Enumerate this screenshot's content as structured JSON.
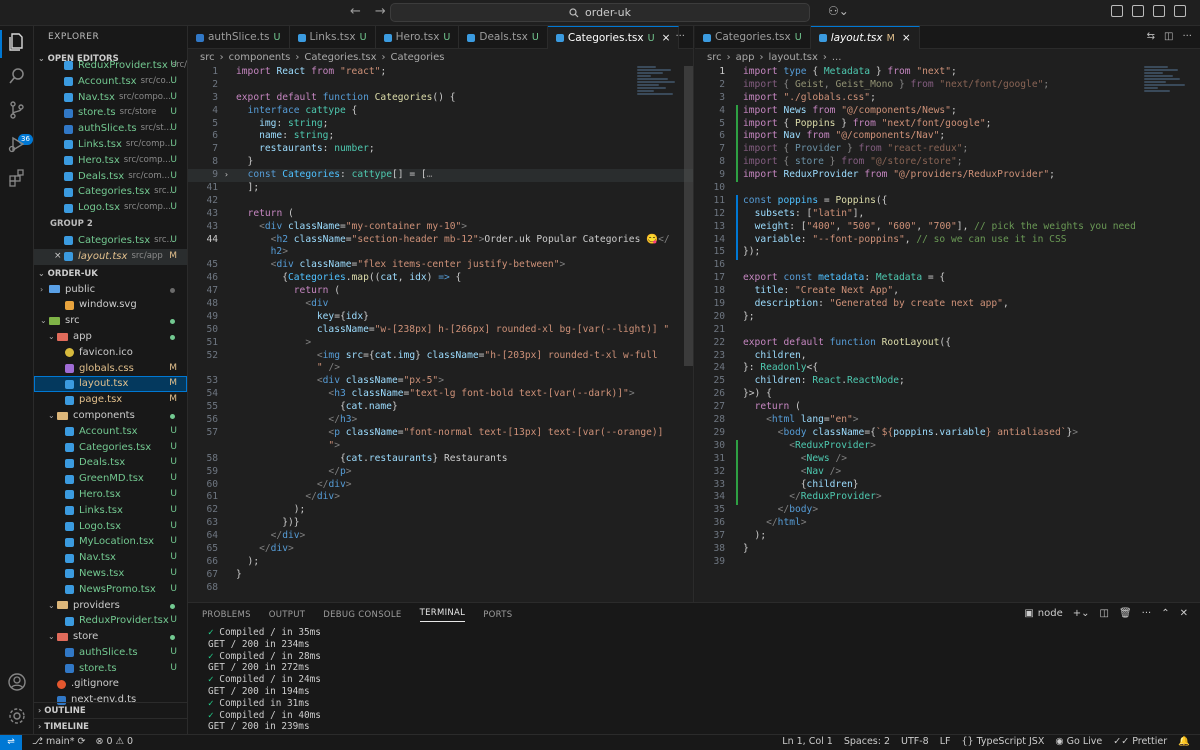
{
  "titlebar": {
    "back": "←",
    "forward": "→",
    "search_text": "order-uk"
  },
  "activity": {
    "badge": "36"
  },
  "sidebar": {
    "title": "EXPLORER",
    "open_editors_label": "OPEN EDITORS",
    "group2_label": "GROUP 2",
    "order_label": "ORDER-UK",
    "outline_label": "OUTLINE",
    "timeline_label": "TIMELINE",
    "open_editors": [
      {
        "name": "ReduxProvider.tsx",
        "path": "src/...",
        "status": "U",
        "icon": "tsx"
      },
      {
        "name": "Account.tsx",
        "path": "src/co...",
        "status": "U",
        "icon": "tsx"
      },
      {
        "name": "Nav.tsx",
        "path": "src/compo...",
        "status": "U",
        "icon": "tsx"
      },
      {
        "name": "store.ts",
        "path": "src/store",
        "status": "U",
        "icon": "ts"
      },
      {
        "name": "authSlice.ts",
        "path": "src/st...",
        "status": "U",
        "icon": "ts"
      },
      {
        "name": "Links.tsx",
        "path": "src/comp...",
        "status": "U",
        "icon": "tsx"
      },
      {
        "name": "Hero.tsx",
        "path": "src/comp...",
        "status": "U",
        "icon": "tsx"
      },
      {
        "name": "Deals.tsx",
        "path": "src/com...",
        "status": "U",
        "icon": "tsx"
      },
      {
        "name": "Categories.tsx",
        "path": "src...",
        "status": "U",
        "icon": "tsx"
      },
      {
        "name": "Logo.tsx",
        "path": "src/comp...",
        "status": "U",
        "icon": "tsx"
      }
    ],
    "group2": [
      {
        "name": "Categories.tsx",
        "path": "src...",
        "status": "U",
        "icon": "tsx"
      },
      {
        "name": "layout.tsx",
        "path": "src/app",
        "status": "M",
        "icon": "tsx"
      }
    ],
    "tree": [
      {
        "name": "public",
        "indent": 1,
        "type": "folder",
        "color": "blue",
        "chev": "›",
        "dot": "grey"
      },
      {
        "name": "window.svg",
        "indent": 3,
        "icon": "svg"
      },
      {
        "name": "src",
        "indent": 1,
        "type": "folder",
        "color": "green",
        "chev": "⌄",
        "dot": "green"
      },
      {
        "name": "app",
        "indent": 2,
        "type": "folder",
        "color": "red",
        "chev": "⌄",
        "dot": "green"
      },
      {
        "name": "favicon.ico",
        "indent": 3,
        "icon": "ico"
      },
      {
        "name": "globals.css",
        "indent": 3,
        "icon": "css",
        "status": "M"
      },
      {
        "name": "layout.tsx",
        "indent": 3,
        "icon": "tsx",
        "status": "M",
        "selected": true
      },
      {
        "name": "page.tsx",
        "indent": 3,
        "icon": "tsx",
        "status": "M"
      },
      {
        "name": "components",
        "indent": 2,
        "type": "folder",
        "color": "",
        "chev": "⌄",
        "dot": "green"
      },
      {
        "name": "Account.tsx",
        "indent": 3,
        "icon": "tsx",
        "status": "U"
      },
      {
        "name": "Categories.tsx",
        "indent": 3,
        "icon": "tsx",
        "status": "U"
      },
      {
        "name": "Deals.tsx",
        "indent": 3,
        "icon": "tsx",
        "status": "U"
      },
      {
        "name": "GreenMD.tsx",
        "indent": 3,
        "icon": "tsx",
        "status": "U"
      },
      {
        "name": "Hero.tsx",
        "indent": 3,
        "icon": "tsx",
        "status": "U"
      },
      {
        "name": "Links.tsx",
        "indent": 3,
        "icon": "tsx",
        "status": "U"
      },
      {
        "name": "Logo.tsx",
        "indent": 3,
        "icon": "tsx",
        "status": "U"
      },
      {
        "name": "MyLocation.tsx",
        "indent": 3,
        "icon": "tsx",
        "status": "U"
      },
      {
        "name": "Nav.tsx",
        "indent": 3,
        "icon": "tsx",
        "status": "U"
      },
      {
        "name": "News.tsx",
        "indent": 3,
        "icon": "tsx",
        "status": "U"
      },
      {
        "name": "NewsPromo.tsx",
        "indent": 3,
        "icon": "tsx",
        "status": "U"
      },
      {
        "name": "providers",
        "indent": 2,
        "type": "folder",
        "color": "",
        "chev": "⌄",
        "dot": "green"
      },
      {
        "name": "ReduxProvider.tsx",
        "indent": 3,
        "icon": "tsx",
        "status": "U"
      },
      {
        "name": "store",
        "indent": 2,
        "type": "folder",
        "color": "red",
        "chev": "⌄",
        "dot": "green"
      },
      {
        "name": "authSlice.ts",
        "indent": 3,
        "icon": "ts",
        "status": "U"
      },
      {
        "name": "store.ts",
        "indent": 3,
        "icon": "ts",
        "status": "U"
      },
      {
        "name": ".gitignore",
        "indent": 2,
        "icon": "git"
      },
      {
        "name": "next-env.d.ts",
        "indent": 2,
        "icon": "ts"
      }
    ]
  },
  "left_editor": {
    "tabs": [
      {
        "name": "authSlice.ts",
        "status": "U",
        "icon": "ts"
      },
      {
        "name": "Links.tsx",
        "status": "U",
        "icon": "tsx"
      },
      {
        "name": "Hero.tsx",
        "status": "U",
        "icon": "tsx"
      },
      {
        "name": "Deals.tsx",
        "status": "U",
        "icon": "tsx"
      },
      {
        "name": "Categories.tsx",
        "status": "U",
        "icon": "tsx",
        "active": true
      }
    ],
    "breadcrumb": [
      "src",
      "components",
      "Categories.tsx",
      "Categories"
    ],
    "lines": [
      {
        "n": "1",
        "t": "<span class=\"kw2\">import</span> <span class=\"va\">React</span> <span class=\"kw2\">from</span> <span class=\"str\">\"react\"</span>;"
      },
      {
        "n": "2",
        "t": ""
      },
      {
        "n": "3",
        "t": "<span class=\"kw2\">export</span> <span class=\"kw2\">default</span> <span class=\"kw\">function</span> <span class=\"fn\">Categories</span>() {"
      },
      {
        "n": "4",
        "t": "  <span class=\"kw\">interface</span> <span class=\"ty\">cattype</span> {"
      },
      {
        "n": "5",
        "t": "    <span class=\"va\">img</span>: <span class=\"ty\">string</span>;"
      },
      {
        "n": "6",
        "t": "    <span class=\"va\">name</span>: <span class=\"ty\">string</span>;"
      },
      {
        "n": "7",
        "t": "    <span class=\"va\">restaurants</span>: <span class=\"ty\">number</span>;"
      },
      {
        "n": "8",
        "t": "  }"
      },
      {
        "n": "9",
        "t": "  <span class=\"kw\">const</span> <span class=\"co\">Categories</span>: <span class=\"ty\">cattype</span>[] = [<span class=\"pn\">…</span>",
        "hl": true,
        "fold": true
      },
      {
        "n": "41",
        "t": "  ];"
      },
      {
        "n": "42",
        "t": ""
      },
      {
        "n": "43",
        "t": "  <span class=\"kw2\">return</span> ("
      },
      {
        "n": "43",
        "t": "    <span class=\"pn\">&lt;</span><span class=\"tg\">div</span> <span class=\"at\">className</span>=<span class=\"str\">\"my-container my-10\"</span><span class=\"pn\">&gt;</span>"
      },
      {
        "n": "44",
        "t": "      <span class=\"pn\">&lt;</span><span class=\"tg\">h2</span> <span class=\"at\">className</span>=<span class=\"str\">\"section-header mb-12\"</span><span class=\"pn\">&gt;</span>Order.uk Popular Categories 😋<span class=\"pn\">&lt;/</span>",
        "cur": true
      },
      {
        "n": "",
        "t": "      <span class=\"tg\">h2</span><span class=\"pn\">&gt;</span>"
      },
      {
        "n": "45",
        "t": "      <span class=\"pn\">&lt;</span><span class=\"tg\">div</span> <span class=\"at\">className</span>=<span class=\"str\">\"flex items-center justify-between\"</span><span class=\"pn\">&gt;</span>"
      },
      {
        "n": "46",
        "t": "        {<span class=\"co\">Categories</span>.<span class=\"fn\">map</span>((<span class=\"va\">cat</span>, <span class=\"va\">idx</span>) <span class=\"kw\">=&gt;</span> {"
      },
      {
        "n": "47",
        "t": "          <span class=\"kw2\">return</span> ("
      },
      {
        "n": "48",
        "t": "            <span class=\"pn\">&lt;</span><span class=\"tg\">div</span>"
      },
      {
        "n": "49",
        "t": "              <span class=\"at\">key</span>={<span class=\"va\">idx</span>}"
      },
      {
        "n": "50",
        "t": "              <span class=\"at\">className</span>=<span class=\"str\">\"w-[238px] h-[266px] rounded-xl bg-[var(--light)] \"</span>"
      },
      {
        "n": "51",
        "t": "            <span class=\"pn\">&gt;</span>"
      },
      {
        "n": "52",
        "t": "              <span class=\"pn\">&lt;</span><span class=\"tg\">img</span> <span class=\"at\">src</span>={<span class=\"va\">cat</span>.<span class=\"va\">img</span>} <span class=\"at\">className</span>=<span class=\"str\">\"h-[203px] rounded-t-xl w-full</span>"
      },
      {
        "n": "",
        "t": "              <span class=\"str\">\"</span> <span class=\"pn\">/&gt;</span>"
      },
      {
        "n": "53",
        "t": "              <span class=\"pn\">&lt;</span><span class=\"tg\">div</span> <span class=\"at\">className</span>=<span class=\"str\">\"px-5\"</span><span class=\"pn\">&gt;</span>"
      },
      {
        "n": "54",
        "t": "                <span class=\"pn\">&lt;</span><span class=\"tg\">h3</span> <span class=\"at\">className</span>=<span class=\"str\">\"text-lg font-bold text-[var(--dark)]\"</span><span class=\"pn\">&gt;</span>"
      },
      {
        "n": "55",
        "t": "                  {<span class=\"va\">cat</span>.<span class=\"va\">name</span>}"
      },
      {
        "n": "56",
        "t": "                <span class=\"pn\">&lt;/</span><span class=\"tg\">h3</span><span class=\"pn\">&gt;</span>"
      },
      {
        "n": "57",
        "t": "                <span class=\"pn\">&lt;</span><span class=\"tg\">p</span> <span class=\"at\">className</span>=<span class=\"str\">\"font-normal text-[13px] text-[var(--orange)]</span>"
      },
      {
        "n": "",
        "t": "                <span class=\"str\">\"</span><span class=\"pn\">&gt;</span>"
      },
      {
        "n": "58",
        "t": "                  {<span class=\"va\">cat</span>.<span class=\"va\">restaurants</span>} Restaurants"
      },
      {
        "n": "59",
        "t": "                <span class=\"pn\">&lt;/</span><span class=\"tg\">p</span><span class=\"pn\">&gt;</span>"
      },
      {
        "n": "60",
        "t": "              <span class=\"pn\">&lt;/</span><span class=\"tg\">div</span><span class=\"pn\">&gt;</span>"
      },
      {
        "n": "61",
        "t": "            <span class=\"pn\">&lt;/</span><span class=\"tg\">div</span><span class=\"pn\">&gt;</span>"
      },
      {
        "n": "62",
        "t": "          );"
      },
      {
        "n": "63",
        "t": "        })}"
      },
      {
        "n": "64",
        "t": "      <span class=\"pn\">&lt;/</span><span class=\"tg\">div</span><span class=\"pn\">&gt;</span>"
      },
      {
        "n": "65",
        "t": "    <span class=\"pn\">&lt;/</span><span class=\"tg\">div</span><span class=\"pn\">&gt;</span>"
      },
      {
        "n": "66",
        "t": "  );"
      },
      {
        "n": "67",
        "t": "}"
      },
      {
        "n": "68",
        "t": ""
      }
    ]
  },
  "right_editor": {
    "tabs": [
      {
        "name": "Categories.tsx",
        "status": "U",
        "icon": "tsx"
      },
      {
        "name": "layout.tsx",
        "status": "M",
        "icon": "tsx",
        "active": true,
        "italic": true
      }
    ],
    "breadcrumb": [
      "src",
      "app",
      "layout.tsx",
      "..."
    ],
    "lines": [
      {
        "n": "1",
        "t": "<span class=\"kw2\">import</span> <span class=\"kw\">type</span> { <span class=\"ty\">Metadata</span> } <span class=\"kw2\">from</span> <span class=\"str\">\"next\"</span>;",
        "cur": true
      },
      {
        "n": "2",
        "t": "<span class=\"dim\"><span class=\"kw2\">import</span> { <span class=\"fn\">Geist</span>, <span class=\"fn\">Geist_Mono</span> } <span class=\"kw2\">from</span> <span class=\"str\">\"next/font/google\"</span>;</span>"
      },
      {
        "n": "3",
        "t": "<span class=\"kw2\">import</span> <span class=\"str\">\"./globals.css\"</span>;"
      },
      {
        "n": "4",
        "t": "<span class=\"kw2\">import</span> <span class=\"va\">News</span> <span class=\"kw2\">from</span> <span class=\"str\">\"@/components/News\"</span>;"
      },
      {
        "n": "5",
        "t": "<span class=\"kw2\">import</span> { <span class=\"fn\">Poppins</span> } <span class=\"kw2\">from</span> <span class=\"str\">\"next/font/google\"</span>;"
      },
      {
        "n": "6",
        "t": "<span class=\"kw2\">import</span> <span class=\"va\">Nav</span> <span class=\"kw2\">from</span> <span class=\"str\">\"@/components/Nav\"</span>;"
      },
      {
        "n": "7",
        "t": "<span class=\"dim\"><span class=\"kw2\">import</span> { <span class=\"va\">Provider</span> } <span class=\"kw2\">from</span> <span class=\"str\">\"react-redux\"</span>;</span>"
      },
      {
        "n": "8",
        "t": "<span class=\"dim\"><span class=\"kw2\">import</span> { <span class=\"va\">store</span> } <span class=\"kw2\">from</span> <span class=\"str\">\"@/store/store\"</span>;</span>"
      },
      {
        "n": "9",
        "t": "<span class=\"kw2\">import</span> <span class=\"va\">ReduxProvider</span> <span class=\"kw2\">from</span> <span class=\"str\">\"@/providers/ReduxProvider\"</span>;"
      },
      {
        "n": "10",
        "t": ""
      },
      {
        "n": "11",
        "t": "<span class=\"kw\">const</span> <span class=\"co\">poppins</span> = <span class=\"fn\">Poppins</span>({"
      },
      {
        "n": "12",
        "t": "  <span class=\"va\">subsets</span>: [<span class=\"str\">\"latin\"</span>],"
      },
      {
        "n": "13",
        "t": "  <span class=\"va\">weight</span>: [<span class=\"str\">\"400\"</span>, <span class=\"str\">\"500\"</span>, <span class=\"str\">\"600\"</span>, <span class=\"str\">\"700\"</span>], <span class=\"cm\">// pick the weights you need</span>"
      },
      {
        "n": "14",
        "t": "  <span class=\"va\">variable</span>: <span class=\"str\">\"--font-poppins\"</span>, <span class=\"cm\">// so we can use it in CSS</span>"
      },
      {
        "n": "15",
        "t": "});"
      },
      {
        "n": "16",
        "t": ""
      },
      {
        "n": "17",
        "t": "<span class=\"kw2\">export</span> <span class=\"kw\">const</span> <span class=\"co\">metadata</span>: <span class=\"ty\">Metadata</span> = {"
      },
      {
        "n": "18",
        "t": "  <span class=\"va\">title</span>: <span class=\"str\">\"Create Next App\"</span>,"
      },
      {
        "n": "19",
        "t": "  <span class=\"va\">description</span>: <span class=\"str\">\"Generated by create next app\"</span>,"
      },
      {
        "n": "20",
        "t": "};"
      },
      {
        "n": "21",
        "t": ""
      },
      {
        "n": "22",
        "t": "<span class=\"kw2\">export</span> <span class=\"kw2\">default</span> <span class=\"kw\">function</span> <span class=\"fn\">RootLayout</span>({"
      },
      {
        "n": "23",
        "t": "  <span class=\"va\">children</span>,"
      },
      {
        "n": "24",
        "t": "}: <span class=\"ty\">Readonly</span>&lt;{"
      },
      {
        "n": "25",
        "t": "  <span class=\"va\">children</span>: <span class=\"ty\">React</span>.<span class=\"ty\">ReactNode</span>;"
      },
      {
        "n": "26",
        "t": "}&gt;) {"
      },
      {
        "n": "27",
        "t": "  <span class=\"kw2\">return</span> ("
      },
      {
        "n": "28",
        "t": "    <span class=\"pn\">&lt;</span><span class=\"tg\">html</span> <span class=\"at\">lang</span>=<span class=\"str\">\"en\"</span><span class=\"pn\">&gt;</span>"
      },
      {
        "n": "29",
        "t": "      <span class=\"pn\">&lt;</span><span class=\"tg\">body</span> <span class=\"at\">className</span>={<span class=\"str\">`${</span><span class=\"va\">poppins</span>.<span class=\"va\">variable</span><span class=\"str\">} antialiased`</span>}<span class=\"pn\">&gt;</span>"
      },
      {
        "n": "30",
        "t": "        <span class=\"pn\">&lt;</span><span class=\"ty\">ReduxProvider</span><span class=\"pn\">&gt;</span>"
      },
      {
        "n": "31",
        "t": "          <span class=\"pn\">&lt;</span><span class=\"ty\">News</span> <span class=\"pn\">/&gt;</span>"
      },
      {
        "n": "32",
        "t": "          <span class=\"pn\">&lt;</span><span class=\"ty\">Nav</span> <span class=\"pn\">/&gt;</span>"
      },
      {
        "n": "33",
        "t": "          {<span class=\"va\">children</span>}"
      },
      {
        "n": "34",
        "t": "        <span class=\"pn\">&lt;/</span><span class=\"ty\">ReduxProvider</span><span class=\"pn\">&gt;</span>"
      },
      {
        "n": "35",
        "t": "      <span class=\"pn\">&lt;/</span><span class=\"tg\">body</span><span class=\"pn\">&gt;</span>"
      },
      {
        "n": "36",
        "t": "    <span class=\"pn\">&lt;/</span><span class=\"tg\">html</span><span class=\"pn\">&gt;</span>"
      },
      {
        "n": "37",
        "t": "  );"
      },
      {
        "n": "38",
        "t": "}"
      },
      {
        "n": "39",
        "t": ""
      }
    ]
  },
  "panel": {
    "tabs": [
      "PROBLEMS",
      "OUTPUT",
      "DEBUG CONSOLE",
      "TERMINAL",
      "PORTS"
    ],
    "active_tab": "TERMINAL",
    "shell": "node",
    "terminal": [
      {
        "ok": true,
        "text": "Compiled / in 35ms"
      },
      {
        "ok": false,
        "text": "GET / 200 in 234ms"
      },
      {
        "ok": true,
        "text": "Compiled / in 28ms"
      },
      {
        "ok": false,
        "text": "GET / 200 in 272ms"
      },
      {
        "ok": true,
        "text": "Compiled / in 24ms"
      },
      {
        "ok": false,
        "text": "GET / 200 in 194ms"
      },
      {
        "ok": true,
        "text": "Compiled in 31ms"
      },
      {
        "ok": true,
        "text": "Compiled / in 40ms"
      },
      {
        "ok": false,
        "text": "GET / 200 in 239ms"
      }
    ]
  },
  "statusbar": {
    "branch": "main*",
    "errors": "0",
    "warnings": "0",
    "position": "Ln 1, Col 1",
    "spaces": "Spaces: 2",
    "encoding": "UTF-8",
    "eol": "LF",
    "language": "TypeScript JSX",
    "golive": "Go Live",
    "prettier": "Prettier"
  }
}
